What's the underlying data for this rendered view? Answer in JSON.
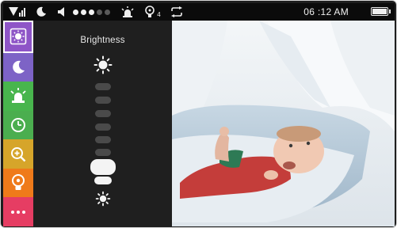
{
  "status_bar": {
    "icons": [
      "signal-icon",
      "moon-icon",
      "speaker-icon",
      "alarm-icon",
      "temperature-icon",
      "repeat-icon"
    ],
    "volume_level": 0.6,
    "volume_dots_on": 3,
    "volume_dots_total": 5,
    "temperature_badge": "4",
    "time": "06 :12 AM",
    "battery_level": 1.0
  },
  "sidebar": {
    "items": [
      {
        "name": "brightness",
        "icon": "brightness-icon",
        "color": "#8e55c7",
        "selected": true
      },
      {
        "name": "night-mode",
        "icon": "moon-icon",
        "color": "#7d63c6"
      },
      {
        "name": "alarm",
        "icon": "alarm-icon",
        "color": "#48b54d"
      },
      {
        "name": "timer",
        "icon": "clock-icon",
        "color": "#4bae4f"
      },
      {
        "name": "zoom",
        "icon": "zoom-in-icon",
        "color": "#d6a52a"
      },
      {
        "name": "temperature",
        "icon": "thermometer-icon",
        "color": "#ef7a1a"
      },
      {
        "name": "more",
        "icon": "more-icon",
        "color": "#e63d63"
      }
    ]
  },
  "brightness_panel": {
    "title": "Brightness",
    "level_steps": 8,
    "selected_step": 7
  }
}
